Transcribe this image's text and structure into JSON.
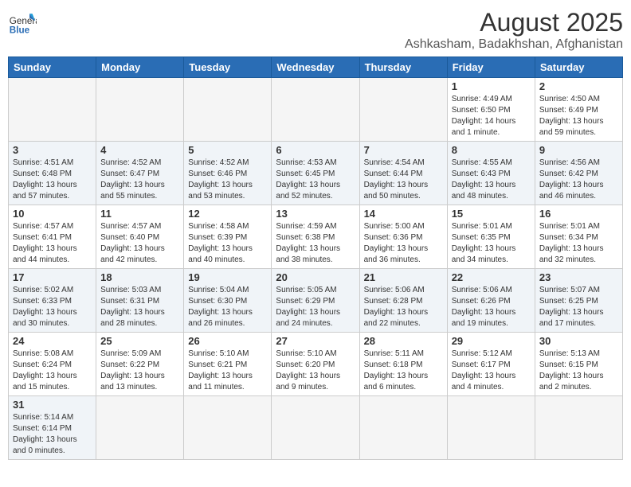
{
  "header": {
    "logo_general": "General",
    "logo_blue": "Blue",
    "title": "August 2025",
    "location": "Ashkasham, Badakhshan, Afghanistan"
  },
  "weekdays": [
    "Sunday",
    "Monday",
    "Tuesday",
    "Wednesday",
    "Thursday",
    "Friday",
    "Saturday"
  ],
  "weeks": [
    [
      {
        "day": "",
        "content": ""
      },
      {
        "day": "",
        "content": ""
      },
      {
        "day": "",
        "content": ""
      },
      {
        "day": "",
        "content": ""
      },
      {
        "day": "",
        "content": ""
      },
      {
        "day": "1",
        "content": "Sunrise: 4:49 AM\nSunset: 6:50 PM\nDaylight: 14 hours and 1 minute."
      },
      {
        "day": "2",
        "content": "Sunrise: 4:50 AM\nSunset: 6:49 PM\nDaylight: 13 hours and 59 minutes."
      }
    ],
    [
      {
        "day": "3",
        "content": "Sunrise: 4:51 AM\nSunset: 6:48 PM\nDaylight: 13 hours and 57 minutes."
      },
      {
        "day": "4",
        "content": "Sunrise: 4:52 AM\nSunset: 6:47 PM\nDaylight: 13 hours and 55 minutes."
      },
      {
        "day": "5",
        "content": "Sunrise: 4:52 AM\nSunset: 6:46 PM\nDaylight: 13 hours and 53 minutes."
      },
      {
        "day": "6",
        "content": "Sunrise: 4:53 AM\nSunset: 6:45 PM\nDaylight: 13 hours and 52 minutes."
      },
      {
        "day": "7",
        "content": "Sunrise: 4:54 AM\nSunset: 6:44 PM\nDaylight: 13 hours and 50 minutes."
      },
      {
        "day": "8",
        "content": "Sunrise: 4:55 AM\nSunset: 6:43 PM\nDaylight: 13 hours and 48 minutes."
      },
      {
        "day": "9",
        "content": "Sunrise: 4:56 AM\nSunset: 6:42 PM\nDaylight: 13 hours and 46 minutes."
      }
    ],
    [
      {
        "day": "10",
        "content": "Sunrise: 4:57 AM\nSunset: 6:41 PM\nDaylight: 13 hours and 44 minutes."
      },
      {
        "day": "11",
        "content": "Sunrise: 4:57 AM\nSunset: 6:40 PM\nDaylight: 13 hours and 42 minutes."
      },
      {
        "day": "12",
        "content": "Sunrise: 4:58 AM\nSunset: 6:39 PM\nDaylight: 13 hours and 40 minutes."
      },
      {
        "day": "13",
        "content": "Sunrise: 4:59 AM\nSunset: 6:38 PM\nDaylight: 13 hours and 38 minutes."
      },
      {
        "day": "14",
        "content": "Sunrise: 5:00 AM\nSunset: 6:36 PM\nDaylight: 13 hours and 36 minutes."
      },
      {
        "day": "15",
        "content": "Sunrise: 5:01 AM\nSunset: 6:35 PM\nDaylight: 13 hours and 34 minutes."
      },
      {
        "day": "16",
        "content": "Sunrise: 5:01 AM\nSunset: 6:34 PM\nDaylight: 13 hours and 32 minutes."
      }
    ],
    [
      {
        "day": "17",
        "content": "Sunrise: 5:02 AM\nSunset: 6:33 PM\nDaylight: 13 hours and 30 minutes."
      },
      {
        "day": "18",
        "content": "Sunrise: 5:03 AM\nSunset: 6:31 PM\nDaylight: 13 hours and 28 minutes."
      },
      {
        "day": "19",
        "content": "Sunrise: 5:04 AM\nSunset: 6:30 PM\nDaylight: 13 hours and 26 minutes."
      },
      {
        "day": "20",
        "content": "Sunrise: 5:05 AM\nSunset: 6:29 PM\nDaylight: 13 hours and 24 minutes."
      },
      {
        "day": "21",
        "content": "Sunrise: 5:06 AM\nSunset: 6:28 PM\nDaylight: 13 hours and 22 minutes."
      },
      {
        "day": "22",
        "content": "Sunrise: 5:06 AM\nSunset: 6:26 PM\nDaylight: 13 hours and 19 minutes."
      },
      {
        "day": "23",
        "content": "Sunrise: 5:07 AM\nSunset: 6:25 PM\nDaylight: 13 hours and 17 minutes."
      }
    ],
    [
      {
        "day": "24",
        "content": "Sunrise: 5:08 AM\nSunset: 6:24 PM\nDaylight: 13 hours and 15 minutes."
      },
      {
        "day": "25",
        "content": "Sunrise: 5:09 AM\nSunset: 6:22 PM\nDaylight: 13 hours and 13 minutes."
      },
      {
        "day": "26",
        "content": "Sunrise: 5:10 AM\nSunset: 6:21 PM\nDaylight: 13 hours and 11 minutes."
      },
      {
        "day": "27",
        "content": "Sunrise: 5:10 AM\nSunset: 6:20 PM\nDaylight: 13 hours and 9 minutes."
      },
      {
        "day": "28",
        "content": "Sunrise: 5:11 AM\nSunset: 6:18 PM\nDaylight: 13 hours and 6 minutes."
      },
      {
        "day": "29",
        "content": "Sunrise: 5:12 AM\nSunset: 6:17 PM\nDaylight: 13 hours and 4 minutes."
      },
      {
        "day": "30",
        "content": "Sunrise: 5:13 AM\nSunset: 6:15 PM\nDaylight: 13 hours and 2 minutes."
      }
    ],
    [
      {
        "day": "31",
        "content": "Sunrise: 5:14 AM\nSunset: 6:14 PM\nDaylight: 13 hours and 0 minutes."
      },
      {
        "day": "",
        "content": ""
      },
      {
        "day": "",
        "content": ""
      },
      {
        "day": "",
        "content": ""
      },
      {
        "day": "",
        "content": ""
      },
      {
        "day": "",
        "content": ""
      },
      {
        "day": "",
        "content": ""
      }
    ]
  ]
}
